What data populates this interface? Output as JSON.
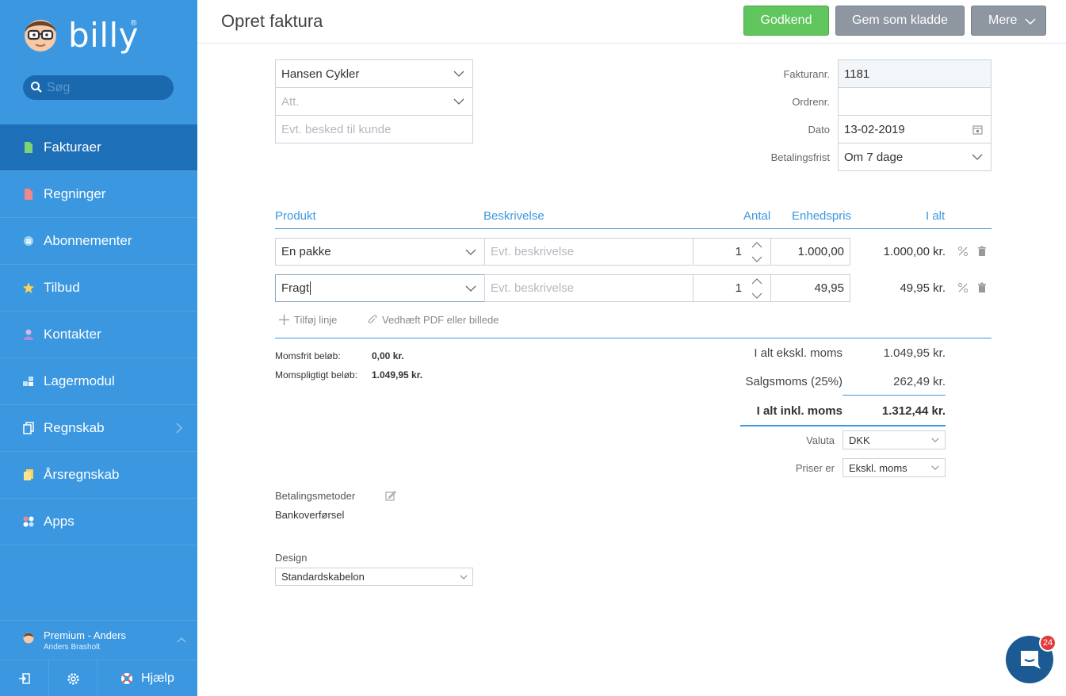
{
  "app": {
    "brand": "billy",
    "reg": "®",
    "search_placeholder": "Søg"
  },
  "sidebar": {
    "items": [
      {
        "label": "Fakturaer",
        "icon": "invoice-icon",
        "color": "#7ed37a"
      },
      {
        "label": "Regninger",
        "icon": "bill-icon",
        "color": "#f08a8a"
      },
      {
        "label": "Abonnementer",
        "icon": "subscription-icon",
        "color": "#9bd2f5"
      },
      {
        "label": "Tilbud",
        "icon": "star-icon",
        "color": "#f7d25c"
      },
      {
        "label": "Kontakter",
        "icon": "contact-icon",
        "color": "#b18be0"
      },
      {
        "label": "Lagermodul",
        "icon": "inventory-icon",
        "color": "#bfe3f9"
      },
      {
        "label": "Regnskab",
        "icon": "accounting-icon",
        "color": "#ffffff"
      },
      {
        "label": "Årsregnskab",
        "icon": "annual-report-icon",
        "color": "#f7d25c"
      },
      {
        "label": "Apps",
        "icon": "apps-icon",
        "color": "#f08a8a"
      }
    ],
    "user_plan": "Premium - Anders",
    "user_name": "Anders Brasholt",
    "help_label": "Hjælp"
  },
  "header": {
    "title": "Opret faktura",
    "approve_label": "Godkend",
    "draft_label": "Gem som kladde",
    "more_label": "Mere"
  },
  "customer": {
    "name": "Hansen Cykler",
    "att_placeholder": "Att.",
    "message_placeholder": "Evt. besked til kunde"
  },
  "meta": {
    "invoice_no_label": "Fakturanr.",
    "invoice_no": "1181",
    "order_no_label": "Ordrenr.",
    "order_no": "",
    "date_label": "Dato",
    "date": "13-02-2019",
    "due_label": "Betalingsfrist",
    "due": "Om 7 dage"
  },
  "lines": {
    "headers": {
      "product": "Produkt",
      "description": "Beskrivelse",
      "qty": "Antal",
      "unit_price": "Enhedspris",
      "total": "I alt"
    },
    "rows": [
      {
        "product": "En pakke",
        "description_placeholder": "Evt. beskrivelse",
        "qty": "1",
        "unit_price": "1.000,00",
        "total": "1.000,00 kr."
      },
      {
        "product": "Fragt",
        "description_placeholder": "Evt. beskrivelse",
        "qty": "1",
        "unit_price": "49,95",
        "total": "49,95 kr."
      }
    ],
    "add_line": "Tilføj linje",
    "attach": "Vedhæft PDF eller billede"
  },
  "vat": {
    "free_label": "Momsfrit beløb:",
    "free_value": "0,00 kr.",
    "liable_label": "Momspligtigt beløb:",
    "liable_value": "1.049,95 kr."
  },
  "totals": {
    "excl_label": "I alt ekskl. moms",
    "excl_value": "1.049,95 kr.",
    "vat_label": "Salgsmoms (25%)",
    "vat_value": "262,49 kr.",
    "incl_label": "I alt inkl. moms",
    "incl_value": "1.312,44 kr.",
    "currency_label": "Valuta",
    "currency": "DKK",
    "prices_label": "Priser er",
    "prices": "Ekskl. moms"
  },
  "payment": {
    "label": "Betalingsmetoder",
    "method": "Bankoverførsel"
  },
  "design": {
    "label": "Design",
    "value": "Standardskabelon"
  },
  "chat": {
    "badge": "24"
  }
}
